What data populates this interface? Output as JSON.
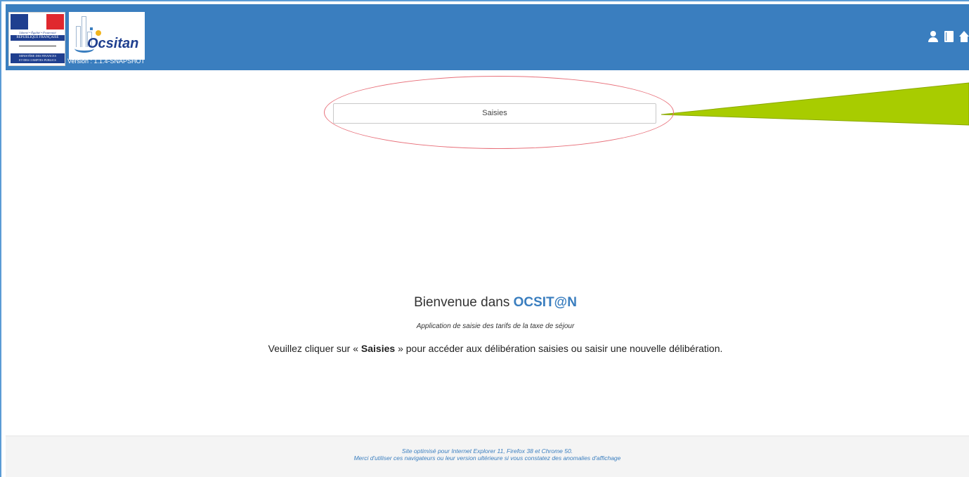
{
  "header": {
    "ministry_logo": {
      "devise": "Liberté • Égalité • Fraternité",
      "republique": "RÉPUBLIQUE FRANÇAISE",
      "ministere_line1": "MINISTÈRE DES FINANCES",
      "ministere_line2": "ET DES COMPTES PUBLICS"
    },
    "app_logo_text": "Ocsitan",
    "version": "Version : 1.1.4-SNAPSHOT",
    "icons": [
      "user-icon",
      "book-icon",
      "home-icon"
    ]
  },
  "main": {
    "saisies_button": "Saisies",
    "welcome_prefix": "Bienvenue dans ",
    "welcome_app": "OCSIT@N",
    "subtitle": "Application de saisie des tarifs de la taxe de séjour",
    "instruction_before": "Veuillez cliquer sur « ",
    "instruction_bold": "Saisies",
    "instruction_after": " » pour accéder aux délibération saisies ou saisir une nouvelle délibération."
  },
  "footer": {
    "line1": "Site optimisé pour Internet Explorer 11, Firefox 38 et Chrome 50.",
    "line2": "Merci d'utiliser ces navigateurs ou leur version ultérieure si vous constatez des anomalies d'affichage"
  },
  "colors": {
    "header_bg": "#3a7ebf",
    "accent": "#3a7ebf",
    "annotation_ellipse": "#e8707a",
    "annotation_arrow": "#a8cc00",
    "footer_bg": "#f4f4f4"
  }
}
